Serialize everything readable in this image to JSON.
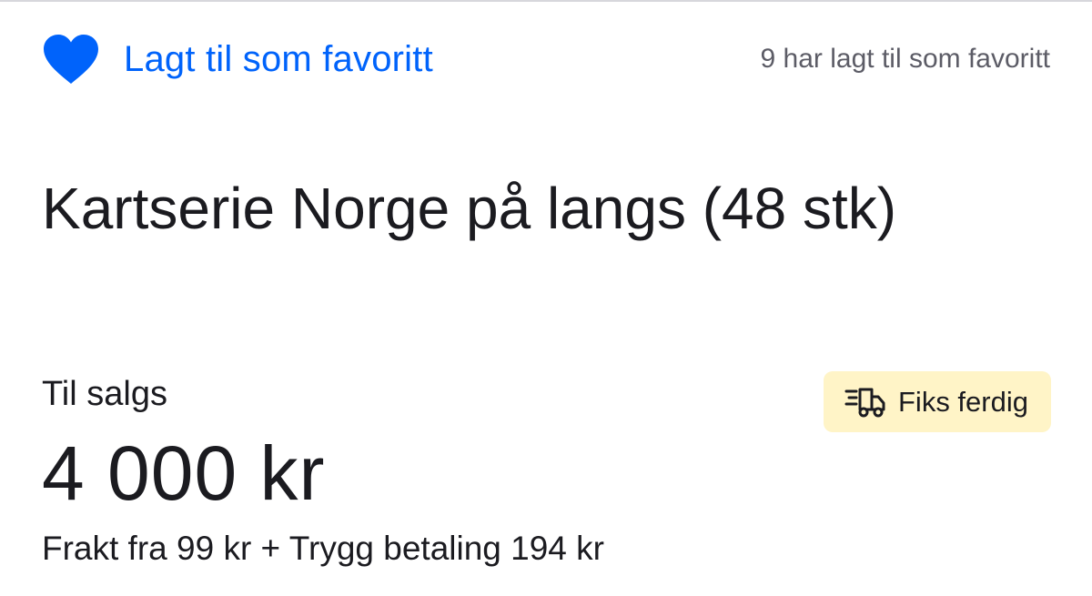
{
  "favorite": {
    "label": "Lagt til som favoritt",
    "count_text": "9 har lagt til som favoritt",
    "icon": "heart-filled-icon"
  },
  "listing": {
    "title": "Kartserie Norge på langs (48 stk)",
    "status": "Til salgs",
    "price": "4 000 kr",
    "shipping": "Frakt fra 99 kr + Trygg betaling 194 kr"
  },
  "badge": {
    "label": "Fiks ferdig",
    "icon": "fast-delivery-truck-icon"
  },
  "colors": {
    "accent": "#0063fb",
    "text": "#1b1b20",
    "muted": "#5c5c66",
    "badge_bg": "#fff4c7"
  }
}
